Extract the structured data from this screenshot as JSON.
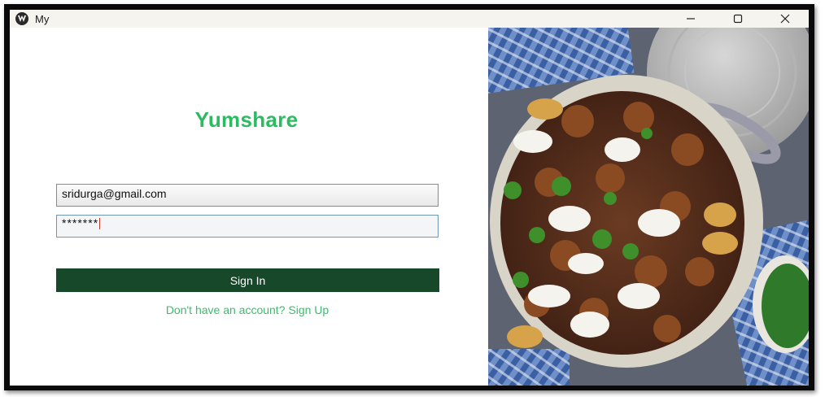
{
  "window": {
    "title": "My",
    "icon": "app-logo-icon",
    "controls": [
      "minimize-icon",
      "maximize-icon",
      "close-icon"
    ]
  },
  "brand": {
    "name": "Yumshare",
    "color": "#2dbb62"
  },
  "login": {
    "email_value": "sridurga@gmail.com",
    "password_value": "*******",
    "signin_label": "Sign In",
    "signup_link": "Don't have an account? Sign Up"
  },
  "colors": {
    "button_bg": "#17482a",
    "link": "#3dbb6d",
    "titlebar": "#f6f4ee"
  },
  "image": {
    "semantic": "food-photo-meatballs-in-pan"
  }
}
